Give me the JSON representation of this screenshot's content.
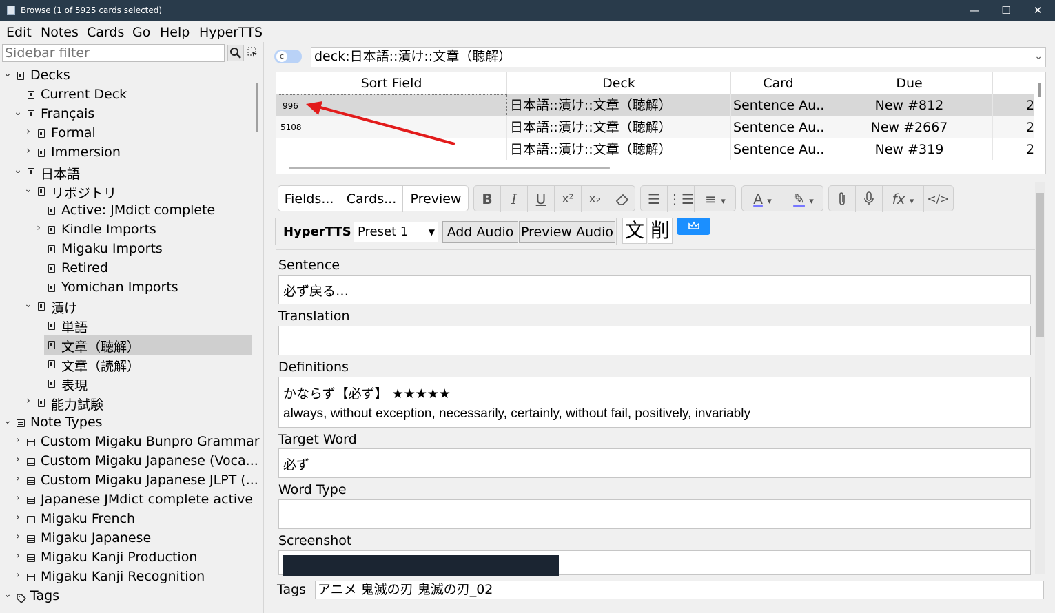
{
  "window": {
    "title": "Browse (1 of 5925 cards selected)",
    "minimize": "—",
    "maximize": "☐",
    "close": "✕"
  },
  "menu": [
    "Edit",
    "Notes",
    "Cards",
    "Go",
    "Help",
    "HyperTTS"
  ],
  "sidebar": {
    "filter_placeholder": "Sidebar filter",
    "items": [
      {
        "label": "Decks"
      },
      {
        "label": "Current Deck"
      },
      {
        "label": "Français"
      },
      {
        "label": "Formal"
      },
      {
        "label": "Immersion"
      },
      {
        "label": "日本語"
      },
      {
        "label": "リポジトリ"
      },
      {
        "label": "Active: JMdict complete"
      },
      {
        "label": "Kindle Imports"
      },
      {
        "label": "Migaku Imports"
      },
      {
        "label": "Retired"
      },
      {
        "label": "Yomichan Imports"
      },
      {
        "label": "漬け"
      },
      {
        "label": "単語"
      },
      {
        "label": "文章（聴解）"
      },
      {
        "label": "文章（読解）"
      },
      {
        "label": "表現"
      },
      {
        "label": "能力試験"
      },
      {
        "label": "Note Types"
      },
      {
        "label": "Custom Migaku Bunpro Grammar"
      },
      {
        "label": "Custom Migaku Japanese (Voca..."
      },
      {
        "label": "Custom Migaku Japanese JLPT (..."
      },
      {
        "label": "Japanese JMdict complete active"
      },
      {
        "label": "Migaku French"
      },
      {
        "label": "Migaku Japanese"
      },
      {
        "label": "Migaku Kanji Production"
      },
      {
        "label": "Migaku Kanji Recognition"
      },
      {
        "label": "Tags"
      }
    ]
  },
  "search": {
    "toggle_label": "c",
    "query": "deck:日本語::漬け::文章（聴解）",
    "dropdown": "⌄"
  },
  "table": {
    "columns": [
      "Sort Field",
      "Deck",
      "Card",
      "Due"
    ],
    "rows": [
      {
        "sort_field": "996",
        "deck": "日本語::漬け::文章（聴解）",
        "card": "Sentence Au...",
        "due": "New #812",
        "extra": "2"
      },
      {
        "sort_field": "5108",
        "deck": "日本語::漬け::文章（聴解）",
        "card": "Sentence Au...",
        "due": "New #2667",
        "extra": "2"
      },
      {
        "sort_field": "",
        "deck": "日本語::漬け::文章（聴解）",
        "card": "Sentence Au...",
        "due": "New #319",
        "extra": "2"
      }
    ]
  },
  "editor": {
    "tabs": [
      "Fields...",
      "Cards...",
      "Preview"
    ],
    "format_buttons": {
      "bold": "B",
      "italic": "I",
      "underline": "U",
      "superscript": "x²",
      "subscript": "x₂",
      "eraser": "⌫",
      "bullets": "☰",
      "numbered": "⋮☰",
      "align": "≡",
      "dropdown": "▾",
      "text_color": "A",
      "highlight": "✎",
      "attach": "📎",
      "record": "🎙",
      "math": "fx",
      "html": "</>"
    },
    "hypertts": {
      "label": "HyperTTS",
      "preset": "Preset 1",
      "add_audio": "Add Audio",
      "preview_audio": "Preview Audio"
    },
    "kanji_buttons": [
      "文",
      "削"
    ],
    "fields": [
      {
        "label": "Sentence",
        "value": "必ず戻る…"
      },
      {
        "label": "Translation",
        "value": ""
      },
      {
        "label": "Definitions",
        "value": "かならず【必ず】 ★★★★★",
        "value2": "always, without exception, necessarily, certainly, without fail, positively, invariably"
      },
      {
        "label": "Target Word",
        "value": "必ず"
      },
      {
        "label": "Word Type",
        "value": ""
      },
      {
        "label": "Screenshot",
        "value": ""
      }
    ],
    "tags_label": "Tags",
    "tags_value": "アニメ 鬼滅の刃 鬼滅の刃_02"
  },
  "colors": {
    "titlebar": "#293b4b",
    "selection": "#cfcfcf",
    "annotation_arrow": "#e21b1b",
    "blue_button": "#1b8fff"
  }
}
